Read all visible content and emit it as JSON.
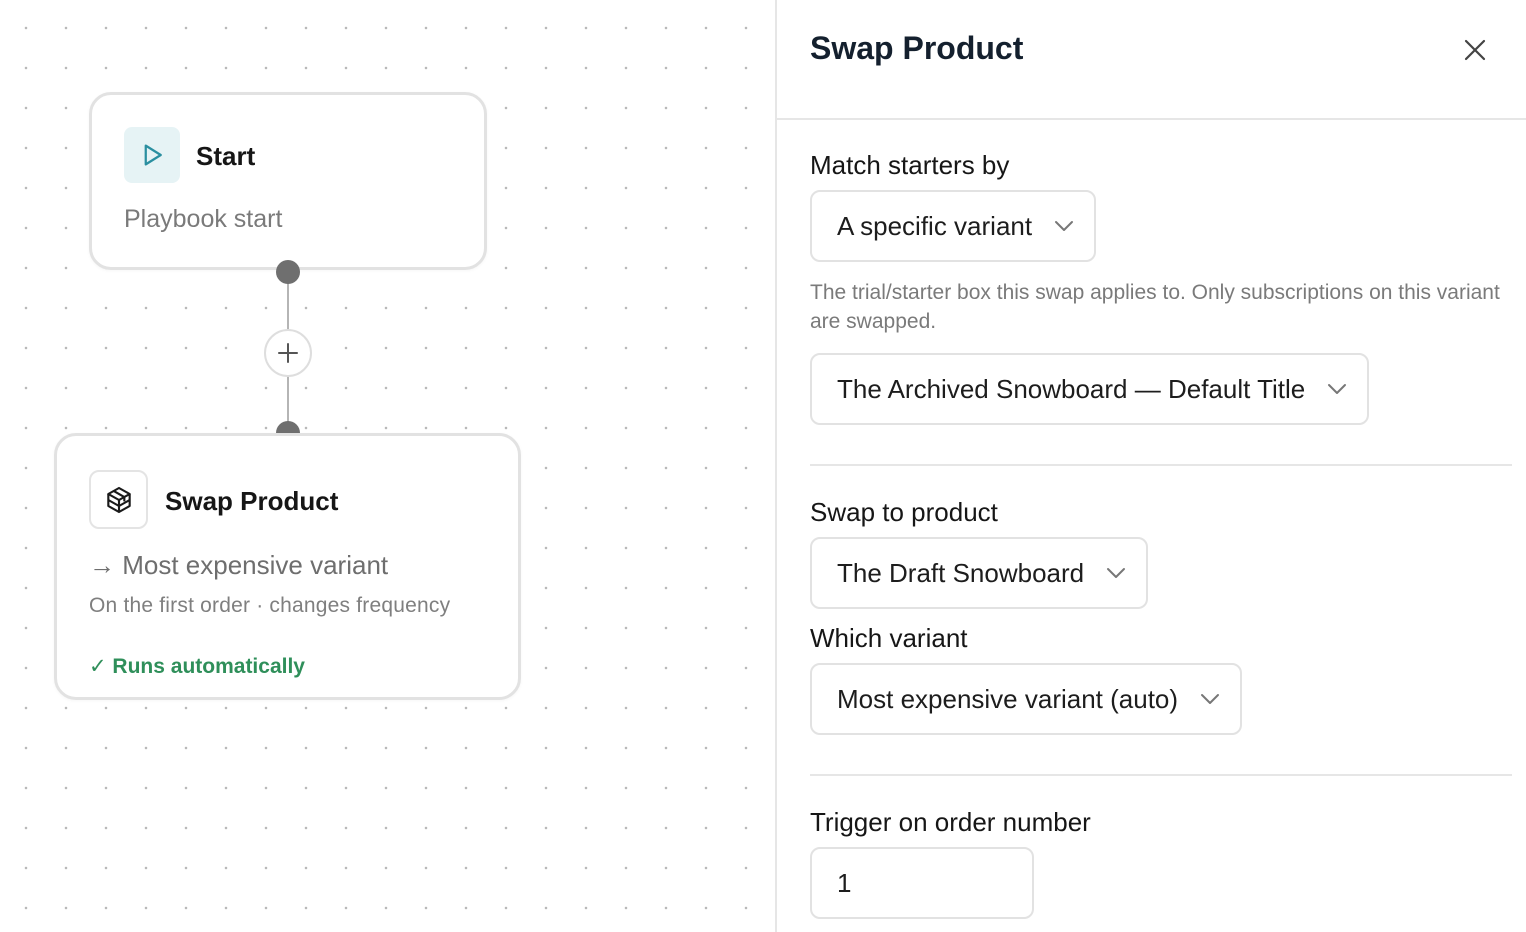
{
  "canvas": {
    "start_node": {
      "title": "Start",
      "subtitle": "Playbook start",
      "icon": "play-icon"
    },
    "add_button": {
      "label": "+"
    },
    "swap_node": {
      "title": "Swap Product",
      "icon": "package-icon",
      "target": "→ Most expensive variant",
      "details": "On the first order · changes frequency",
      "status": "✓ Runs automatically"
    }
  },
  "panel": {
    "title": "Swap Product",
    "close_icon": "close-icon",
    "match_starters": {
      "label": "Match starters by",
      "value": "A specific variant",
      "helper": "The trial/starter box this swap applies to. Only subscriptions on this variant are swapped."
    },
    "starter_variant": {
      "value": "The Archived Snowboard — Default Title"
    },
    "swap_to_product": {
      "label": "Swap to product",
      "value": "The Draft Snowboard"
    },
    "which_variant": {
      "label": "Which variant",
      "value": "Most expensive variant (auto)"
    },
    "trigger_order": {
      "label": "Trigger on order number",
      "value": "1"
    }
  },
  "colors": {
    "accent_teal": "#2a8fa0",
    "success_green": "#2f8f5a",
    "border": "#e2e2e2"
  }
}
